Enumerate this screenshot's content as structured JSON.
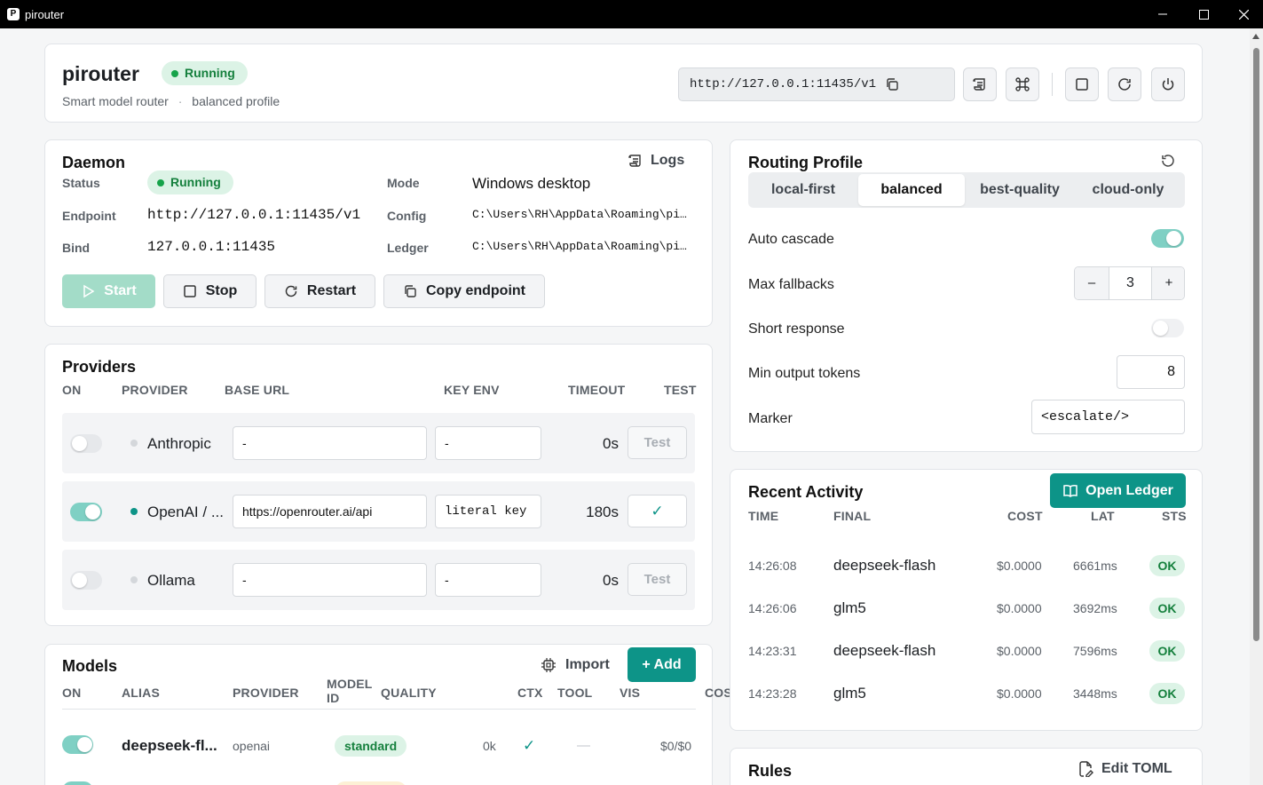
{
  "window": {
    "title": "pirouter",
    "app_icon_letter": "P"
  },
  "header": {
    "title": "pirouter",
    "status": "Running",
    "subtitle": "Smart model router",
    "subtitle_sep": "·",
    "profile": "balanced profile",
    "endpoint": "http://127.0.0.1:11435/v1"
  },
  "daemon": {
    "title": "Daemon",
    "logs_label": "Logs",
    "status_label": "Status",
    "status_value": "Running",
    "endpoint_label": "Endpoint",
    "endpoint_value": "http://127.0.0.1:11435/v1",
    "bind_label": "Bind",
    "bind_value": "127.0.0.1:11435",
    "mode_label": "Mode",
    "mode_value": "Windows desktop",
    "config_label": "Config",
    "config_value": "C:\\Users\\RH\\AppData\\Roaming\\pi…",
    "ledger_label": "Ledger",
    "ledger_value": "C:\\Users\\RH\\AppData\\Roaming\\pi…",
    "start_label": "Start",
    "stop_label": "Stop",
    "restart_label": "Restart",
    "copy_label": "Copy endpoint"
  },
  "providers": {
    "title": "Providers",
    "columns": [
      "ON",
      "PROVIDER",
      "BASE URL",
      "KEY ENV",
      "TIMEOUT",
      "TEST"
    ],
    "rows": [
      {
        "on": false,
        "name": "Anthropic",
        "base_url": "-",
        "key_env": "-",
        "timeout": "0s",
        "test": "Test"
      },
      {
        "on": true,
        "name": "OpenAI / ...",
        "base_url": "https://openrouter.ai/api",
        "key_env": "literal key",
        "timeout": "180s",
        "test": "✓"
      },
      {
        "on": false,
        "name": "Ollama",
        "base_url": "-",
        "key_env": "-",
        "timeout": "0s",
        "test": "Test"
      }
    ]
  },
  "models": {
    "title": "Models",
    "import_label": "Import",
    "add_label": "+ Add",
    "columns": {
      "on": "ON",
      "alias": "ALIAS",
      "provider": "PROVIDER",
      "model_id_1": "MODEL",
      "model_id_2": "ID",
      "quality": "QUALITY",
      "ctx": "CTX",
      "tool": "TOOL",
      "vis": "VIS",
      "cost": "COS"
    },
    "rows": [
      {
        "on": true,
        "alias": "deepseek-fl...",
        "provider": "openai",
        "quality": "standard",
        "ctx": "0k",
        "tool": "✓",
        "vis": "—",
        "cost": "$0/$0"
      }
    ]
  },
  "routing": {
    "title": "Routing Profile",
    "tabs": [
      "local-first",
      "balanced",
      "best-quality",
      "cloud-only"
    ],
    "selected": "balanced",
    "auto_cascade_label": "Auto cascade",
    "auto_cascade": true,
    "max_fallbacks_label": "Max fallbacks",
    "max_fallbacks": "3",
    "minus": "–",
    "plus": "+",
    "short_response_label": "Short response",
    "short_response": false,
    "min_tokens_label": "Min output tokens",
    "min_tokens": "8",
    "marker_label": "Marker",
    "marker": "<escalate/>"
  },
  "activity": {
    "title": "Recent Activity",
    "open_ledger_label": "Open Ledger",
    "columns": [
      "TIME",
      "FINAL",
      "COST",
      "LAT",
      "STS"
    ],
    "rows": [
      {
        "time": "14:26:08",
        "final": "deepseek-flash",
        "cost": "$0.0000",
        "lat": "6661ms",
        "sts": "OK"
      },
      {
        "time": "14:26:06",
        "final": "glm5",
        "cost": "$0.0000",
        "lat": "3692ms",
        "sts": "OK"
      },
      {
        "time": "14:23:31",
        "final": "deepseek-flash",
        "cost": "$0.0000",
        "lat": "7596ms",
        "sts": "OK"
      },
      {
        "time": "14:23:28",
        "final": "glm5",
        "cost": "$0.0000",
        "lat": "3448ms",
        "sts": "OK"
      }
    ]
  },
  "rules": {
    "title": "Rules",
    "edit_label": "Edit TOML"
  },
  "colors": {
    "accent": "#0d9488",
    "running_bg": "#dcf3e6",
    "running_fg": "#15803d",
    "toggle_on": "#7fd0c4"
  }
}
